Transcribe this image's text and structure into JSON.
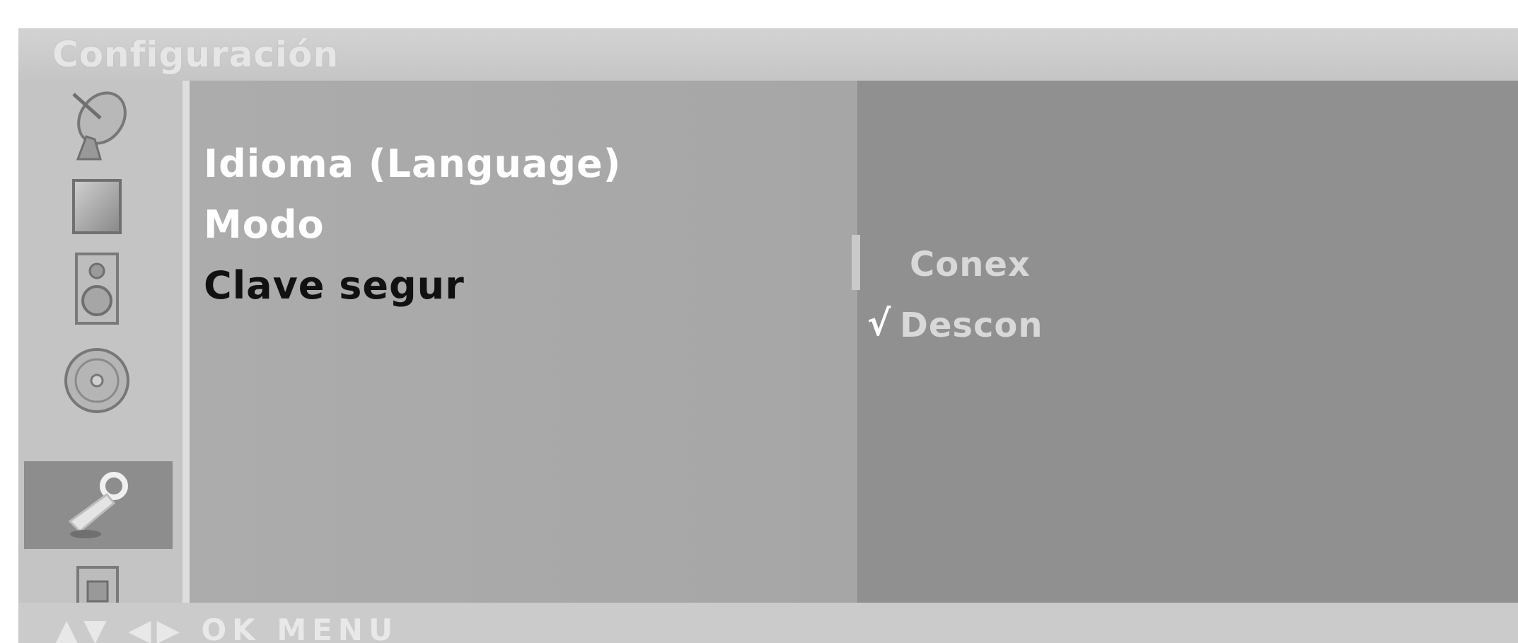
{
  "title": "Configuración",
  "sidebar": {
    "icons": [
      {
        "name": "satellite-dish-icon",
        "selected": false
      },
      {
        "name": "picture-icon",
        "selected": false
      },
      {
        "name": "speaker-icon",
        "selected": false
      },
      {
        "name": "disc-icon",
        "selected": false
      },
      {
        "name": "wrench-icon",
        "selected": true
      },
      {
        "name": "lock-icon",
        "selected": false
      }
    ]
  },
  "menu": {
    "items": [
      {
        "label": "Idioma (Language)"
      },
      {
        "label": "Modo"
      },
      {
        "label": "Clave segur"
      }
    ]
  },
  "options": {
    "items": [
      {
        "label": "Conex",
        "checked": false
      },
      {
        "label": "Descon",
        "checked": true
      }
    ],
    "check_mark": "√"
  },
  "footer": {
    "hint": "▲▼ ◀▶ OK MENU"
  },
  "colors": {
    "menu_panel": "#a9a9a9",
    "option_panel": "#8f908f",
    "selected_icon_bg": "#8d8d8d"
  }
}
